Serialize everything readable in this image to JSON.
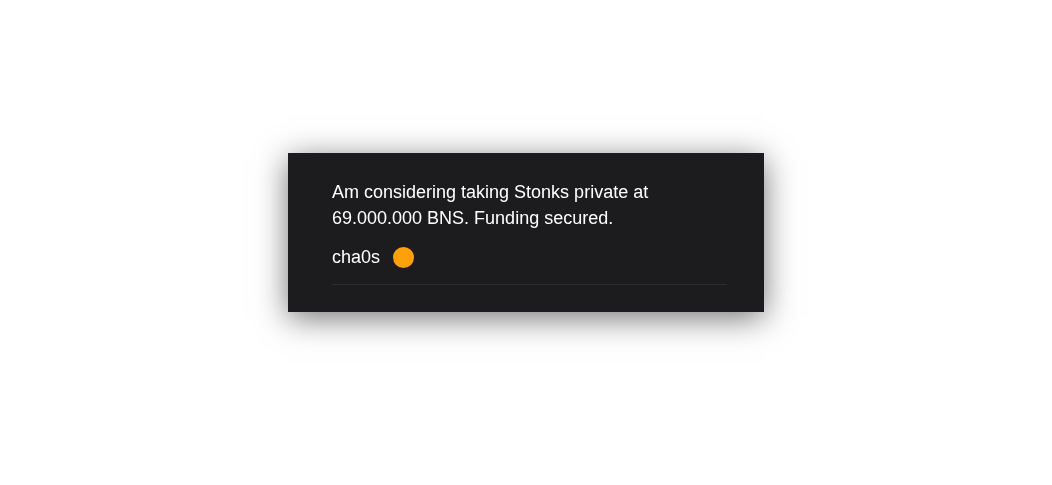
{
  "post": {
    "message": "Am considering taking Stonks private at 69.000.000 BNS. Funding secured.",
    "author": "cha0s"
  }
}
